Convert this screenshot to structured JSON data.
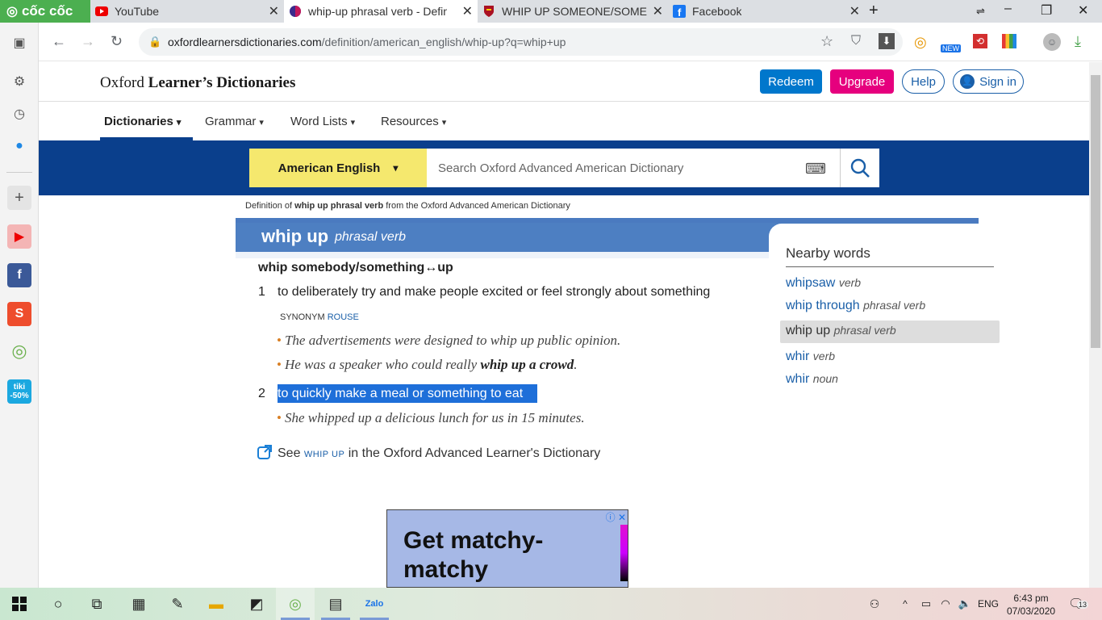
{
  "browser": {
    "brand": "cốc cốc",
    "tabs": [
      {
        "title": "YouTube"
      },
      {
        "title": "whip-up phrasal verb - Definit"
      },
      {
        "title": "WHIP UP SOMEONE/SOMETH"
      },
      {
        "title": "Facebook"
      }
    ],
    "address": {
      "host": "oxfordlearnersdictionaries.com",
      "path": "/definition/american_english/whip-up?q=whip+up"
    },
    "extension_badge": "NEW"
  },
  "site": {
    "logo_regular": "Oxford ",
    "logo_bold": "Learner’s Dictionaries",
    "buttons": {
      "redeem": "Redeem",
      "upgrade": "Upgrade",
      "help": "Help",
      "signin": "Sign in"
    },
    "menu": [
      {
        "label": "Dictionaries"
      },
      {
        "label": "Grammar"
      },
      {
        "label": "Word Lists"
      },
      {
        "label": "Resources"
      }
    ],
    "search": {
      "dictionary": "American English",
      "placeholder": "Search Oxford Advanced American Dictionary"
    }
  },
  "entry": {
    "source_prefix": "Definition of ",
    "source_word": "whip up phrasal verb",
    "source_suffix": " from the Oxford Advanced American Dictionary",
    "headword": "whip up",
    "pos": "phrasal verb",
    "phrase": "whip somebody/something↔up",
    "senses": [
      {
        "num": "1",
        "def": "to deliberately try and make people excited or feel strongly about something",
        "synonym_label": "SYNONYM",
        "synonym": "ROUSE",
        "examples": [
          {
            "text": "The advertisements were designed to whip up public opinion."
          },
          {
            "pre": "He was a speaker who could really ",
            "bold": "whip up a crowd",
            "post": "."
          }
        ]
      },
      {
        "num": "2",
        "def": "to quickly make a meal or something to eat",
        "examples": [
          {
            "text": "She whipped up a delicious lunch for us in 15 minutes."
          }
        ]
      }
    ],
    "see_also": {
      "pre": "See ",
      "word": "WHIP UP",
      "post": " in the Oxford Advanced Learner's Dictionary"
    }
  },
  "nearby": {
    "title": "Nearby words",
    "items": [
      {
        "word": "whipsaw",
        "pos": "verb"
      },
      {
        "word": "whip through",
        "pos": "phrasal verb"
      },
      {
        "word": "whip up",
        "pos": "phrasal verb"
      },
      {
        "word": "whir",
        "pos": "verb"
      },
      {
        "word": "whir",
        "pos": "noun"
      }
    ]
  },
  "ad": {
    "text": "Get matchy-matchy"
  },
  "taskbar": {
    "language": "ENG",
    "time": "6:43 pm",
    "date": "07/03/2020",
    "notifications": "13"
  },
  "sidebar_badge": {
    "line1": "tiki",
    "line2": "-50%"
  }
}
